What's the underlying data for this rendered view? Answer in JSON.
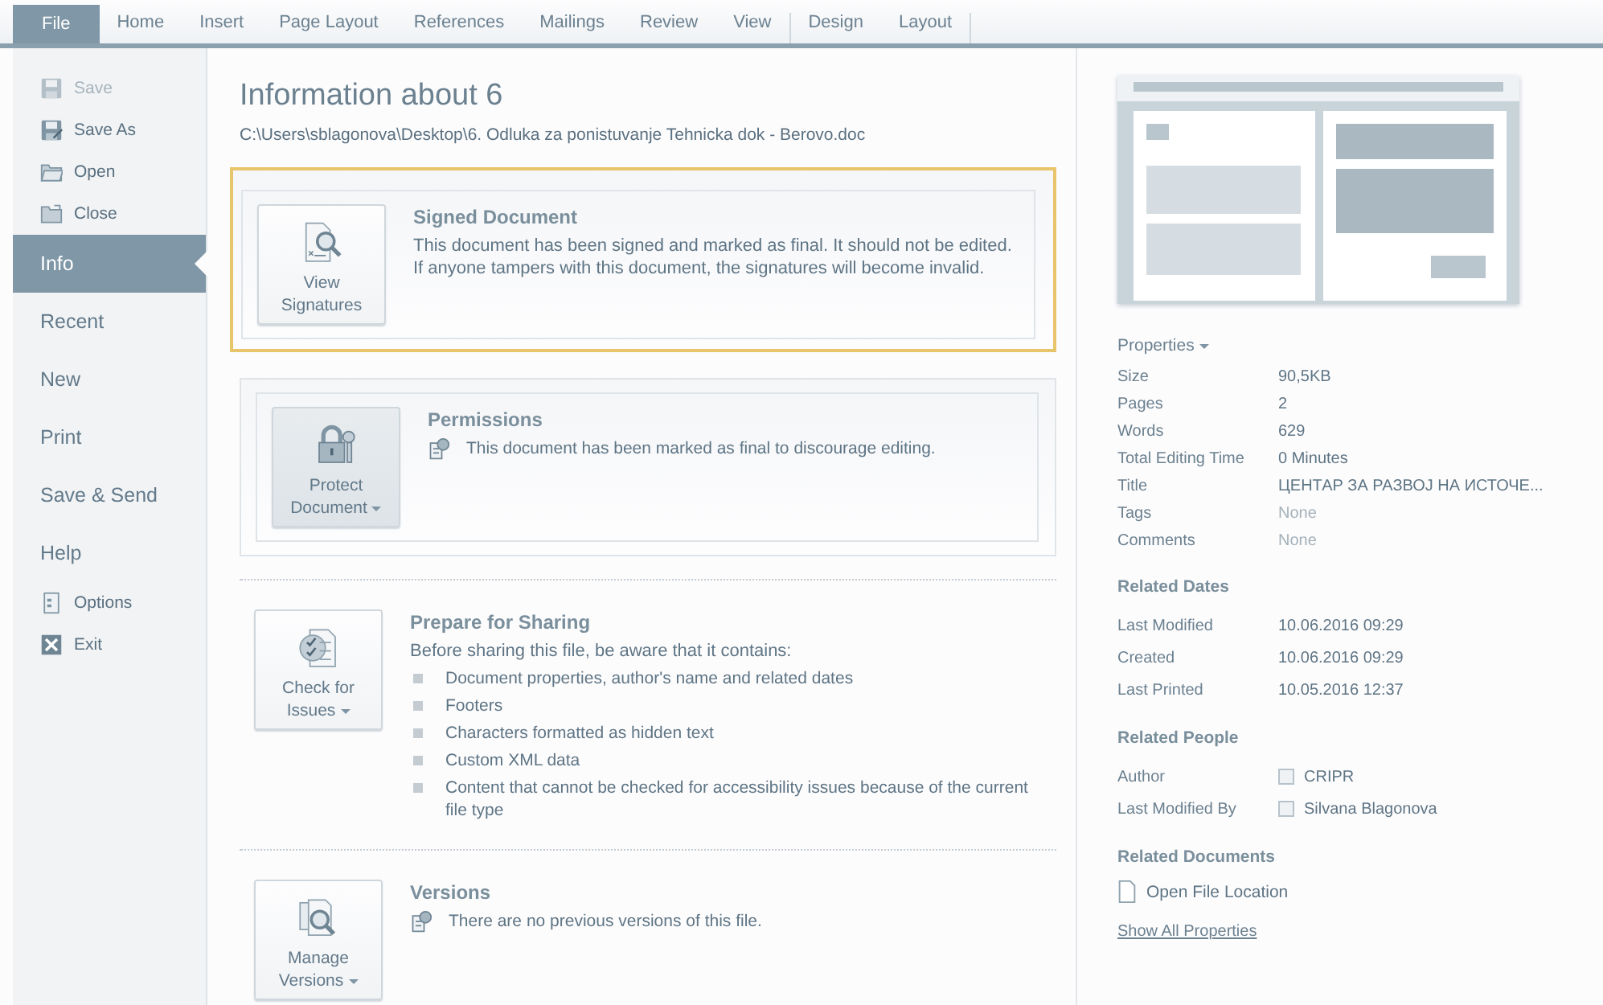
{
  "ribbon": {
    "tabs": [
      {
        "label": "File",
        "selected": true
      },
      {
        "label": "Home",
        "selected": false
      },
      {
        "label": "Insert",
        "selected": false
      },
      {
        "label": "Page Layout",
        "selected": false
      },
      {
        "label": "References",
        "selected": false
      },
      {
        "label": "Mailings",
        "selected": false
      },
      {
        "label": "Review",
        "selected": false
      },
      {
        "label": "View",
        "selected": false
      },
      {
        "label": "Design",
        "selected": false
      },
      {
        "label": "Layout",
        "selected": false
      }
    ]
  },
  "sidebar": {
    "items": [
      {
        "kind": "command",
        "label": "Save",
        "disabled": true,
        "selected": false
      },
      {
        "kind": "command",
        "label": "Save As",
        "disabled": false,
        "selected": false
      },
      {
        "kind": "command",
        "label": "Open",
        "disabled": false,
        "selected": false
      },
      {
        "kind": "command",
        "label": "Close",
        "disabled": false,
        "selected": false
      },
      {
        "kind": "page",
        "label": "Info",
        "disabled": false,
        "selected": true
      },
      {
        "kind": "page",
        "label": "Recent",
        "disabled": false,
        "selected": false
      },
      {
        "kind": "page",
        "label": "New",
        "disabled": false,
        "selected": false
      },
      {
        "kind": "page",
        "label": "Print",
        "disabled": false,
        "selected": false
      },
      {
        "kind": "page",
        "label": "Save & Send",
        "disabled": false,
        "selected": false
      },
      {
        "kind": "page",
        "label": "Help",
        "disabled": false,
        "selected": false
      },
      {
        "kind": "command",
        "label": "Options",
        "disabled": false,
        "selected": false
      },
      {
        "kind": "command",
        "label": "Exit",
        "disabled": false,
        "selected": false
      }
    ]
  },
  "info": {
    "title": "Information about 6",
    "path": "C:\\Users\\sblagonova\\Desktop\\6. Odluka za ponistuvanje Tehnicka dok - Berovo.doc",
    "sections": [
      {
        "kind": "card",
        "highlighted": true,
        "button": {
          "label": "View Signatures",
          "dropdown": false,
          "pressed": false
        },
        "title": "Signed Document",
        "text": "This document has been signed and marked as final. It should not be edited.  If anyone tampers with this document, the signatures will become invalid."
      },
      {
        "kind": "card",
        "highlighted": false,
        "button": {
          "label": "Protect Document",
          "dropdown": true,
          "pressed": true
        },
        "title": "Permissions",
        "note": "This document has been marked as final to discourage editing."
      },
      {
        "kind": "plain",
        "highlighted": false,
        "button": {
          "label": "Check for Issues",
          "dropdown": true,
          "pressed": false
        },
        "title": "Prepare for Sharing",
        "text": "Before sharing this file, be aware that it contains:",
        "bullets": [
          "Document properties, author's name and related dates",
          "Footers",
          "Characters formatted as hidden text",
          "Custom XML data",
          "Content that cannot be checked for accessibility issues because of the current file type"
        ]
      },
      {
        "kind": "plain",
        "highlighted": false,
        "button": {
          "label": "Manage Versions",
          "dropdown": true,
          "pressed": false
        },
        "title": "Versions",
        "note": "There are no previous versions of this file."
      }
    ]
  },
  "details": {
    "groups": [
      {
        "kind": "properties",
        "heading": "Properties",
        "rows": [
          {
            "label": "Size",
            "value": "90,5KB",
            "muted": false
          },
          {
            "label": "Pages",
            "value": "2",
            "muted": false
          },
          {
            "label": "Words",
            "value": "629",
            "muted": false
          },
          {
            "label": "Total Editing Time",
            "value": "0 Minutes",
            "muted": false
          },
          {
            "label": "Title",
            "value": "ЦЕНТАР ЗА РАЗВОЈ НА ИСТОЧЕ...",
            "muted": false
          },
          {
            "label": "Tags",
            "value": "None",
            "muted": true
          },
          {
            "label": "Comments",
            "value": "None",
            "muted": true
          }
        ]
      },
      {
        "kind": "dates",
        "heading": "Related Dates",
        "rows": [
          {
            "label": "Last Modified",
            "value": "10.06.2016 09:29",
            "muted": false
          },
          {
            "label": "Created",
            "value": "10.06.2016 09:29",
            "muted": false
          },
          {
            "label": "Last Printed",
            "value": "10.05.2016 12:37",
            "muted": false
          }
        ]
      },
      {
        "kind": "people",
        "heading": "Related People",
        "rows": [
          {
            "label": "Author",
            "value": "CRIPR",
            "muted": false
          },
          {
            "label": "Last Modified By",
            "value": "Silvana Blagonova",
            "muted": false
          }
        ]
      },
      {
        "kind": "documents",
        "heading": "Related Documents",
        "rows": [
          {
            "label": "Open File Location"
          }
        ]
      }
    ],
    "link": "Show All Properties"
  }
}
